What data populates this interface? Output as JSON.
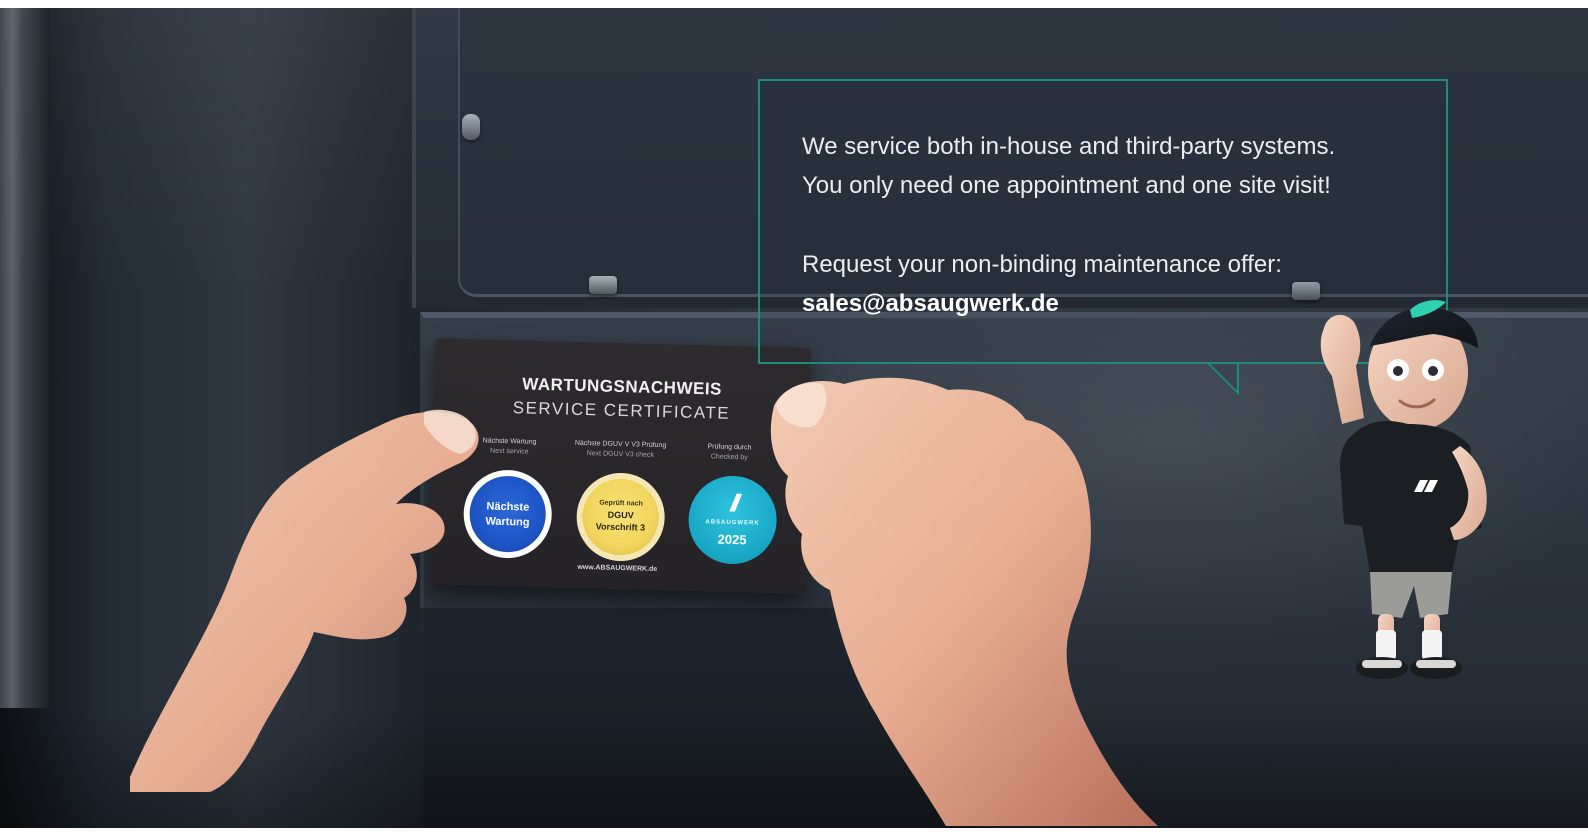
{
  "callout": {
    "line1": "We service both in-house and third-party systems.",
    "line2": "You only need one appointment and one site visit!",
    "line3": "Request your non-binding maintenance offer:",
    "email": "sales@absaugwerk.de"
  },
  "certificate_card": {
    "title": "WARTUNGSNACHWEIS",
    "subtitle": "SERVICE CERTIFICATE",
    "columns": [
      {
        "label": "Nächste Wartung",
        "sublabel": "Next service"
      },
      {
        "label": "Nächste DGUV V V3 Prüfung",
        "sublabel": "Next DGUV V3 check"
      },
      {
        "label": "Prüfung durch",
        "sublabel": "Checked by"
      }
    ],
    "badges": [
      {
        "main_line1": "Nächste",
        "main_line2": "Wartung",
        "color": "#1f56c7"
      },
      {
        "main_line1": "Geprüft nach",
        "main_line2": "DGUV",
        "main_line3": "Vorschrift 3",
        "color": "#f1d55c"
      },
      {
        "logo": "//",
        "brand": "ABSAUGWERK",
        "year": "2025",
        "color": "#19a9c6"
      }
    ],
    "url": "www.ABSAUGWERK.de"
  },
  "colors": {
    "accent": "#1e8c79",
    "background": "#232a33",
    "text": "#e9edf0"
  },
  "icons": {
    "mascot": "mascot-character",
    "logo": "absaugwerk-logo-icon"
  }
}
